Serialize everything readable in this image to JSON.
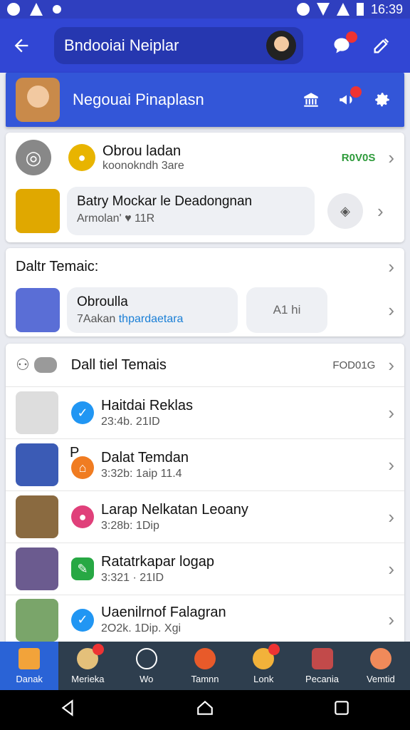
{
  "status": {
    "time": "16:39"
  },
  "appbar": {
    "title": "Bndooiai Neiplar"
  },
  "banner": {
    "name": "Negouai Pinaplasn"
  },
  "card1": {
    "row1": {
      "title": "Obrou ladan",
      "sub": "koonokndh 3are",
      "tag": "R0V0S"
    },
    "row2": {
      "title": "Batry Mockar le Deadongnan",
      "sub": "Armolan' ♥ 11R"
    }
  },
  "card2": {
    "header": "Daltr Temaic:",
    "row": {
      "title": "Obroulla",
      "sub_a": "7Aakan",
      "sub_b": "thpardaetara",
      "side": "A1 hi"
    }
  },
  "card3": {
    "header": "Dall tiel Temais",
    "tag": "FOD01G",
    "items": [
      {
        "title": "Haitdai Reklas",
        "sub": "23:4b. 21ID"
      },
      {
        "title": "Dalat Temdan",
        "sub": "3:32b: 1aip  11.4",
        "prefix": "P"
      },
      {
        "title": "Larap Nelkatan Leoany",
        "sub": "3:28b: 1Dip"
      },
      {
        "title": "Ratatrkapar logap",
        "sub": "3:321 · 21ID"
      },
      {
        "title": "Uaenilrnof Falagran",
        "sub": "2O2k. 1Dip. Xgi"
      }
    ]
  },
  "nav": [
    {
      "label": "Danak"
    },
    {
      "label": "Merieka"
    },
    {
      "label": "Wo"
    },
    {
      "label": "Tamnn"
    },
    {
      "label": "Lonk"
    },
    {
      "label": "Pecania"
    },
    {
      "label": "Vemtid"
    }
  ],
  "colors": {
    "primary": "#3146d4",
    "accent_green": "#2e9b3b",
    "badge": "#e33333"
  }
}
